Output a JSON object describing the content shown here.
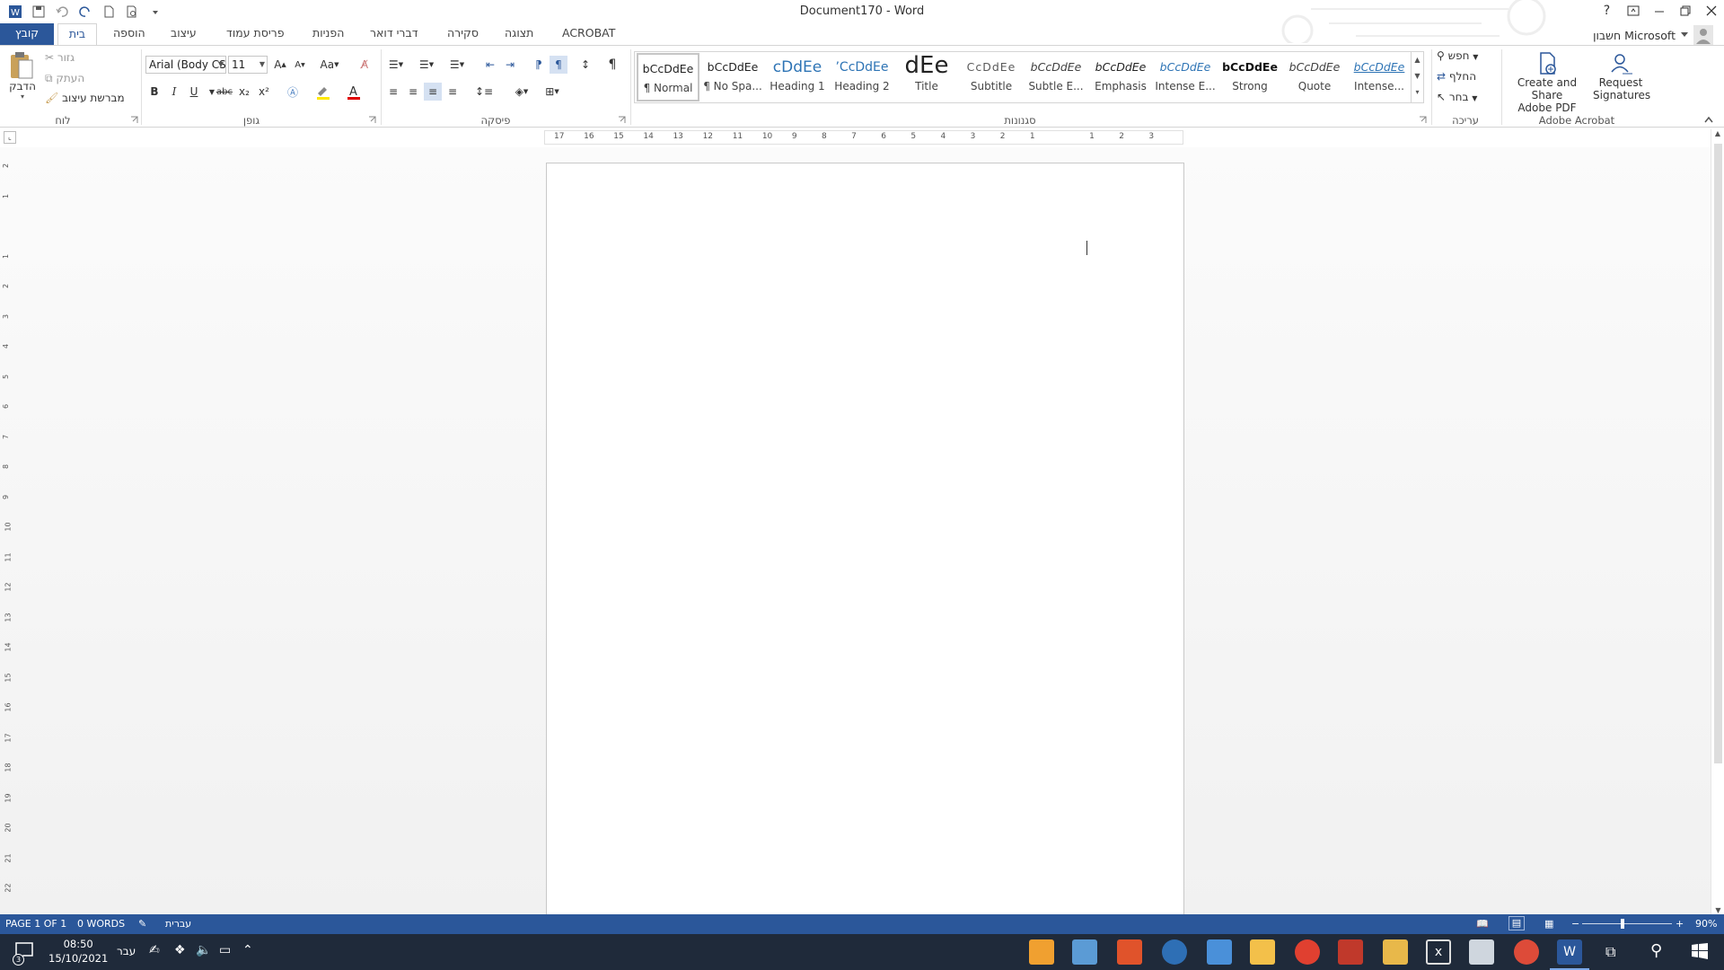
{
  "window": {
    "title": "Document170 - Word",
    "help": "?",
    "account": "חשבון Microsoft"
  },
  "tabs": [
    "קובץ",
    "בית",
    "הוספה",
    "עיצוב",
    "פריסת עמוד",
    "הפניות",
    "דברי דואר",
    "סקירה",
    "תצוגה",
    "ACROBAT"
  ],
  "clipboard": {
    "paste": "הדבק",
    "cut": "גזור",
    "copy": "העתק",
    "format_painter": "מברשת עיצוב",
    "label": "לוח"
  },
  "font": {
    "name": "Arial (Body CS",
    "size": "11",
    "change_case": "Aa",
    "label": "גופן",
    "bold": "B",
    "italic": "I",
    "underline": "U",
    "strike": "abc",
    "subscript": "x₂",
    "superscript": "x²"
  },
  "paragraph": {
    "label": "פיסקה"
  },
  "styles": {
    "label": "סגנונות",
    "items": [
      {
        "preview": "bCcDdEe",
        "name": "¶ Normal",
        "color": "#222222"
      },
      {
        "preview": "bCcDdEe",
        "name": "¶ No Spa...",
        "color": "#222222"
      },
      {
        "preview": "cDdEe",
        "name": "Heading 1",
        "color": "#2e74b5"
      },
      {
        "preview": "’CcDdEe",
        "name": "Heading 2",
        "color": "#2e74b5"
      },
      {
        "preview": "dEe",
        "name": "Title",
        "color": "#222222"
      },
      {
        "preview": "CcDdEe",
        "name": "Subtitle",
        "color": "#5a5a5a"
      },
      {
        "preview": "bCcDdEe",
        "name": "Subtle E...",
        "color": "#404040"
      },
      {
        "preview": "bCcDdEe",
        "name": "Emphasis",
        "color": "#222222"
      },
      {
        "preview": "bCcDdEe",
        "name": "Intense E...",
        "color": "#2e74b5"
      },
      {
        "preview": "bCcDdEe",
        "name": "Strong",
        "color": "#111111"
      },
      {
        "preview": "bCcDdEe",
        "name": "Quote",
        "color": "#404040"
      },
      {
        "preview": "bCcDdEe",
        "name": "Intense...",
        "color": "#2e74b5"
      }
    ]
  },
  "editing": {
    "label": "עריכה",
    "find": "חפש",
    "replace": "החלף",
    "select": "בחר"
  },
  "acrobat": {
    "label": "Adobe Acrobat",
    "create_l1": "Create and Share",
    "create_l2": "Adobe PDF",
    "request_l1": "Request",
    "request_l2": "Signatures"
  },
  "ruler": {
    "top_ticks": [
      "17",
      "16",
      "15",
      "14",
      "13",
      "12",
      "11",
      "10",
      "9",
      "8",
      "7",
      "6",
      "5",
      "4",
      "3",
      "2",
      "1",
      "",
      "1",
      "2",
      "3"
    ],
    "side_ticks": [
      "2",
      "1",
      "",
      "1",
      "2",
      "3",
      "4",
      "5",
      "6",
      "7",
      "8",
      "9",
      "10",
      "11",
      "12",
      "13",
      "14",
      "15",
      "16",
      "17",
      "18",
      "19",
      "20",
      "21",
      "22"
    ]
  },
  "status": {
    "page": "PAGE 1 OF 1",
    "words": "0 WORDS",
    "language": "עברית",
    "zoom": "90%",
    "zoom_level": 0.45
  },
  "taskbar": {
    "time": "08:50",
    "date": "15/10/2021",
    "lang": "עבר",
    "notification_count": "3"
  },
  "colors": {
    "word_blue": "#2b579a",
    "taskbar": "#1f2a3a"
  }
}
